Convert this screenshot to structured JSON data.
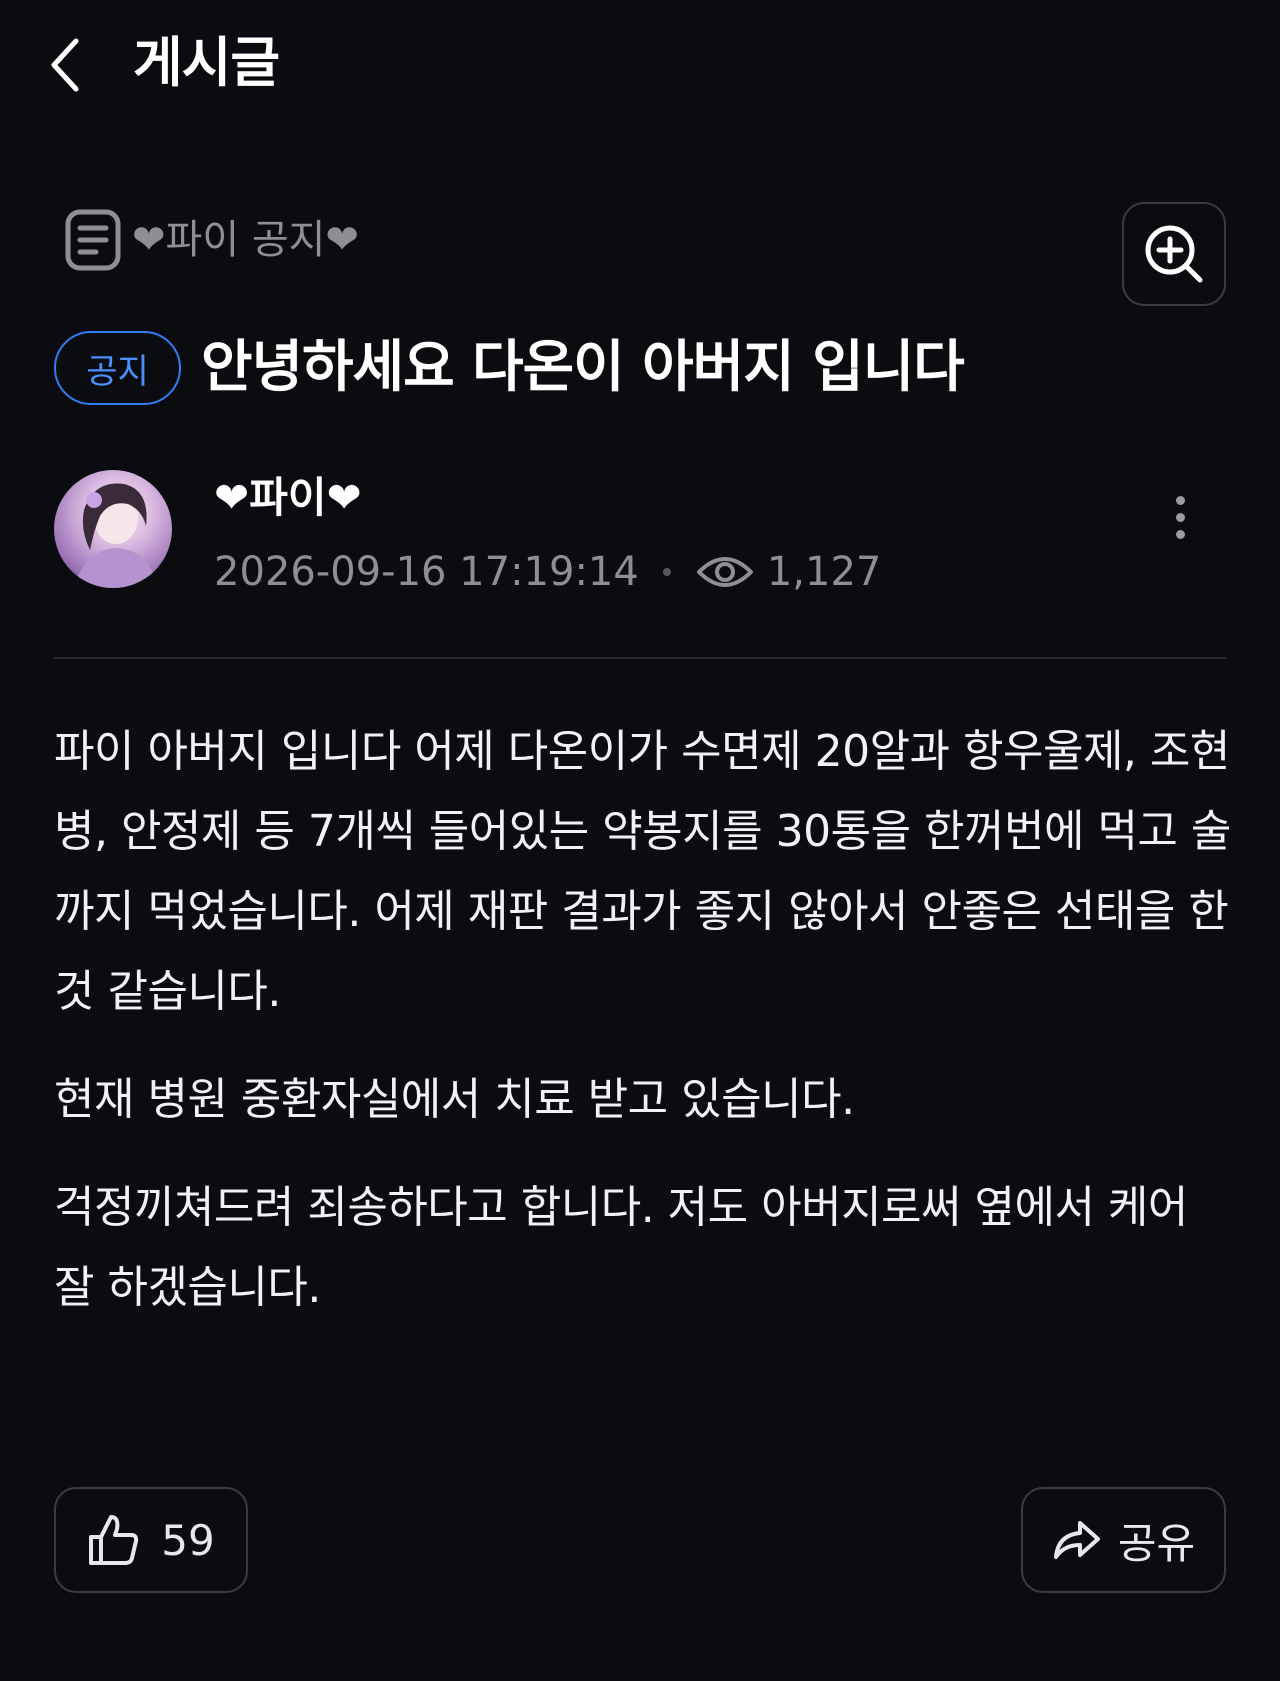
{
  "header": {
    "title": "게시글",
    "back_icon": "chevron-left-icon"
  },
  "board": {
    "name": "❤파이 공지❤",
    "icon": "document-icon"
  },
  "post": {
    "badge": "공지",
    "title": "안녕하세요 다온이 아버지 입니다",
    "author": "❤파이❤",
    "datetime": "2026-09-16 17:19:14",
    "views": "1,127",
    "paragraphs": [
      "파이 아버지 입니다 어제 다온이가 수면제 20알과 항우울제, 조현병, 안정제 등 7개씩 들어있는 약봉지를 30통을 한꺼번에 먹고 술까지 먹었습니다. 어제 재판 결과가 좋지 않아서 안좋은 선태을 한것 같습니다.",
      "현재 병원 중환자실에서 치료 받고 있습니다.",
      "걱정끼쳐드려 죄송하다고 합니다. 저도 아버지로써 옆에서 케어 잘 하겠습니다."
    ]
  },
  "actions": {
    "like_count": "59",
    "share_label": "공유"
  },
  "colors": {
    "background": "#0b0c0f",
    "accent": "#2f7df5",
    "muted_text": "#8d8f95",
    "border": "#3a3c41"
  }
}
